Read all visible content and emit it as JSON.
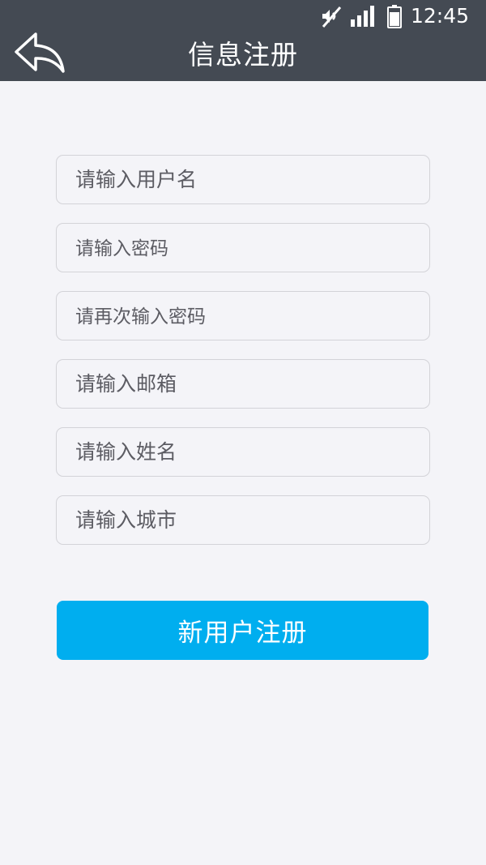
{
  "status_bar": {
    "time": "12:45",
    "icons": [
      "mute-icon",
      "signal-icon",
      "battery-icon"
    ]
  },
  "header": {
    "title": "信息注册",
    "back_icon": "back-arrow-icon",
    "background_color": "#444a53"
  },
  "form": {
    "fields": [
      {
        "name": "username",
        "placeholder": "请输入用户名",
        "value": ""
      },
      {
        "name": "password",
        "placeholder": "请输入密码",
        "value": ""
      },
      {
        "name": "confirm-password",
        "placeholder": "请再次输入密码",
        "value": ""
      },
      {
        "name": "email",
        "placeholder": "请输入邮箱",
        "value": ""
      },
      {
        "name": "real-name",
        "placeholder": "请输入姓名",
        "value": ""
      },
      {
        "name": "city",
        "placeholder": "请输入城市",
        "value": ""
      }
    ]
  },
  "register_button": {
    "label": "新用户注册",
    "color": "#00aeef"
  },
  "page_background": "#f4f4f8"
}
